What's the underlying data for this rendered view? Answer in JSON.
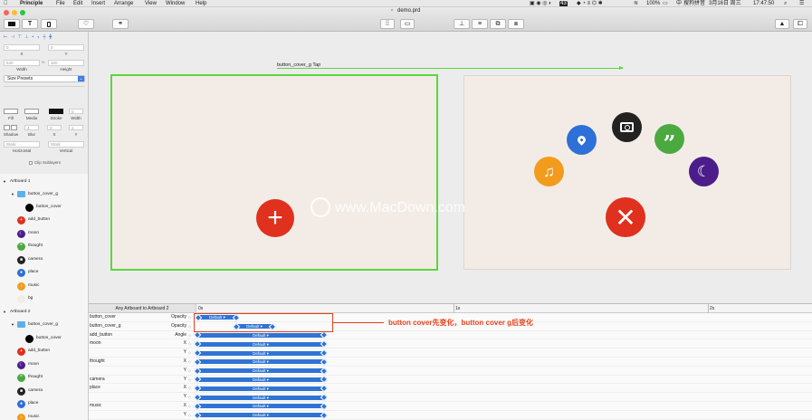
{
  "menubar": {
    "app_name": "Principle",
    "items": [
      "File",
      "Edit",
      "Insert",
      "Arrange",
      "View",
      "Window",
      "Help"
    ],
    "status": {
      "badge_count": "43",
      "battery": "100%",
      "input_method": "搜狗拼音",
      "date": "3月16日 周三",
      "time": "17:47:50"
    }
  },
  "window": {
    "title": "demo.prd"
  },
  "inspector": {
    "xy_values": [
      "0",
      "0"
    ],
    "xy_labels": [
      "X",
      "Y"
    ],
    "size_values": [
      "540",
      "320"
    ],
    "size_labels": [
      "Width",
      "Height"
    ],
    "size_presets": "Size Presets",
    "appearance_labels": [
      "Fill",
      "Media",
      "Stroke",
      "Width"
    ],
    "stroke_width": "0",
    "shadow_labels": [
      "Shadow",
      "Blur",
      "X",
      "Y"
    ],
    "shadow_values": [
      "4",
      "0",
      "2"
    ],
    "static_values": [
      "Static",
      "Static"
    ],
    "static_labels": [
      "Horizontal",
      "Vertical"
    ],
    "clip_sublayers": "Clip Sublayers"
  },
  "layers": [
    {
      "name": "Artboard 1",
      "kind": "artboard"
    },
    {
      "name": "button_cover_g",
      "kind": "group"
    },
    {
      "name": "button_cover",
      "kind": "layer",
      "color": "#000000"
    },
    {
      "name": "add_button",
      "kind": "layer",
      "color": "#e0301e",
      "icon": "+"
    },
    {
      "name": "moon",
      "kind": "layer",
      "color": "#4c1d8a",
      "icon": "☾"
    },
    {
      "name": "thought",
      "kind": "layer",
      "color": "#4aaa3f",
      "icon": "❞"
    },
    {
      "name": "camera",
      "kind": "layer",
      "color": "#222222",
      "icon": "■"
    },
    {
      "name": "place",
      "kind": "layer",
      "color": "#2e6fd8",
      "icon": "●"
    },
    {
      "name": "music",
      "kind": "layer",
      "color": "#f29b1d",
      "icon": "♪"
    },
    {
      "name": "bg",
      "kind": "layer",
      "color": "#f3ece6",
      "icon": ""
    },
    {
      "name": "Artboard 2",
      "kind": "artboard"
    },
    {
      "name": "button_cover_g",
      "kind": "group"
    },
    {
      "name": "button_cover",
      "kind": "layer",
      "color": "#000000"
    },
    {
      "name": "add_button",
      "kind": "layer",
      "color": "#e0301e",
      "icon": "+"
    },
    {
      "name": "moon",
      "kind": "layer",
      "color": "#4c1d8a",
      "icon": "☾"
    },
    {
      "name": "thought",
      "kind": "layer",
      "color": "#4aaa3f",
      "icon": "❞"
    },
    {
      "name": "camera",
      "kind": "layer",
      "color": "#222222",
      "icon": "■"
    },
    {
      "name": "place",
      "kind": "layer",
      "color": "#2e6fd8",
      "icon": "●"
    },
    {
      "name": "music",
      "kind": "layer",
      "color": "#f29b1d",
      "icon": "♪"
    }
  ],
  "canvas": {
    "transition_label": "button_cover_g Tap",
    "watermark": "www.MacDown.com",
    "selection_color": "#5bd63d",
    "artboard_bg": "#f3ece6"
  },
  "timeline": {
    "header": "Any Artboard to Artboard 2",
    "ticks": [
      "0s",
      "1s",
      "2s"
    ],
    "bar_label": "Default",
    "rows": [
      {
        "layer": "button_cover",
        "prop": "Opacity"
      },
      {
        "layer": "button_cover_g",
        "prop": "Opacity"
      },
      {
        "layer": "add_button",
        "prop": "Angle"
      },
      {
        "layer": "moon",
        "prop": "X"
      },
      {
        "layer": "",
        "prop": "Y"
      },
      {
        "layer": "thought",
        "prop": "X"
      },
      {
        "layer": "",
        "prop": "Y"
      },
      {
        "layer": "camera",
        "prop": "Y"
      },
      {
        "layer": "place",
        "prop": "X"
      },
      {
        "layer": "",
        "prop": "Y"
      },
      {
        "layer": "music",
        "prop": "X"
      },
      {
        "layer": "",
        "prop": "Y"
      }
    ],
    "annotation": "button cover先变化，button cover g后变化",
    "annotation_color": "#e8421f"
  }
}
